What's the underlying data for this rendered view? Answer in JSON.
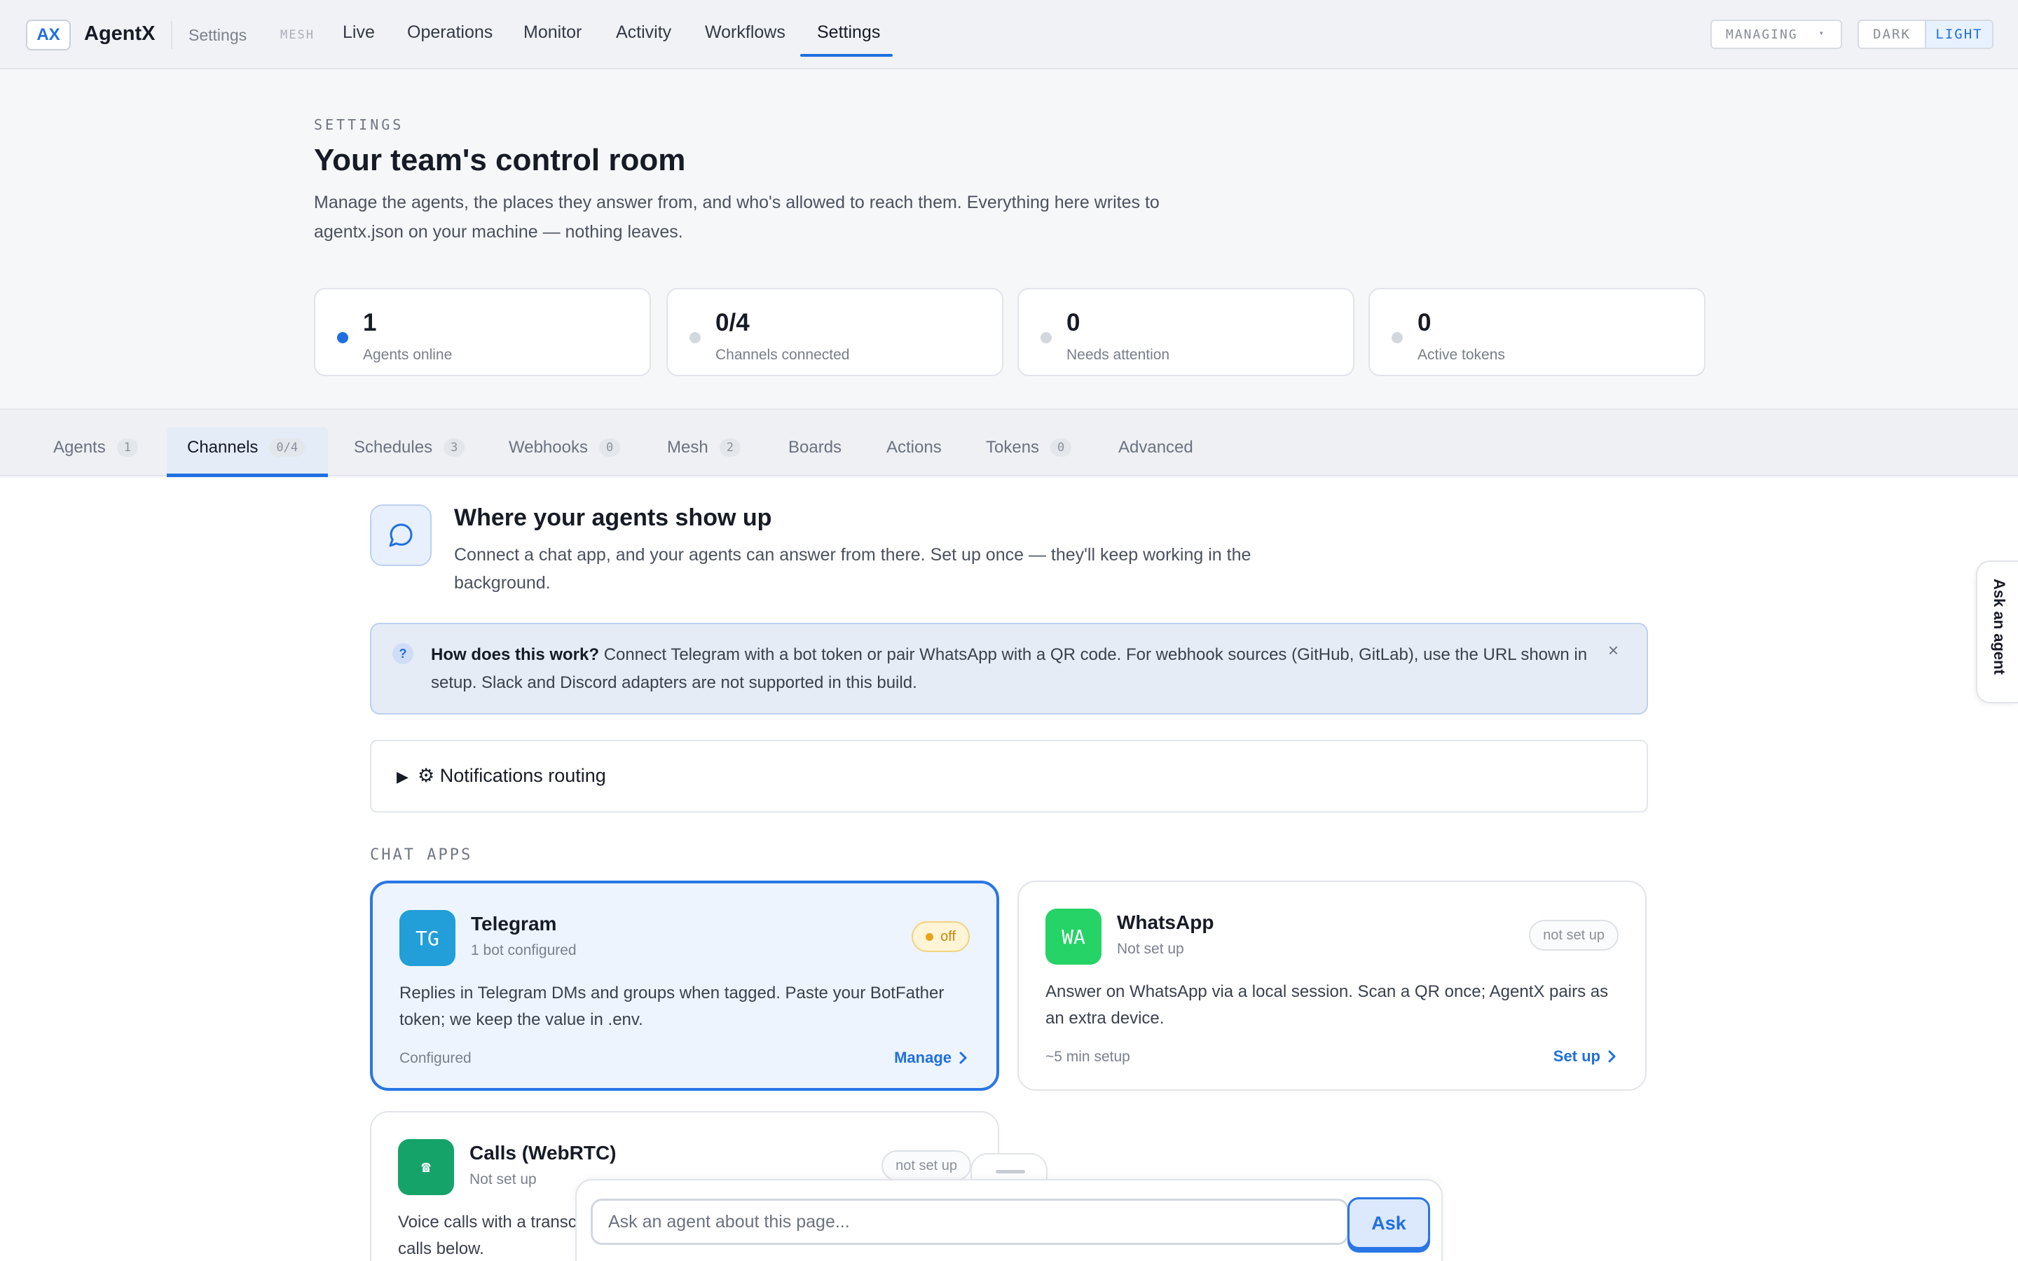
{
  "topbar": {
    "logo": "AX",
    "brand": "AgentX",
    "breadcrumb": "Settings",
    "mesh_tag": "MESH",
    "nav": [
      "Live",
      "Operations",
      "Monitor",
      "Activity",
      "Workflows",
      "Settings"
    ],
    "active_nav": "Settings",
    "managing_label": "MANAGING",
    "theme_dark": "DARK",
    "theme_light": "LIGHT",
    "active_theme": "LIGHT"
  },
  "header": {
    "eyebrow": "SETTINGS",
    "title": "Your team's control room",
    "description": "Manage the agents, the places they answer from, and who's allowed to reach them. Everything here writes to agentx.json on your machine — nothing leaves."
  },
  "stats": [
    {
      "value": "1",
      "label": "Agents online",
      "status": "active"
    },
    {
      "value": "0/4",
      "label": "Channels connected",
      "status": "idle"
    },
    {
      "value": "0",
      "label": "Needs attention",
      "status": "idle"
    },
    {
      "value": "0",
      "label": "Active tokens",
      "status": "idle"
    }
  ],
  "tabs": [
    {
      "label": "Agents",
      "count": "1"
    },
    {
      "label": "Channels",
      "count": "0/4"
    },
    {
      "label": "Schedules",
      "count": "3"
    },
    {
      "label": "Webhooks",
      "count": "0"
    },
    {
      "label": "Mesh",
      "count": "2"
    },
    {
      "label": "Boards",
      "count": ""
    },
    {
      "label": "Actions",
      "count": ""
    },
    {
      "label": "Tokens",
      "count": "0"
    },
    {
      "label": "Advanced",
      "count": ""
    }
  ],
  "active_tab": "Channels",
  "channels": {
    "title": "Where your agents show up",
    "description": "Connect a chat app, and your agents can answer from there. Set up once — they'll keep working in the background.",
    "info": {
      "heading": "How does this work?",
      "text": "Connect Telegram with a bot token or pair WhatsApp with a QR code. For webhook sources (GitHub, GitLab), use the URL shown in setup. Slack and Discord adapters are not supported in this build.",
      "close": "×"
    },
    "notifications": {
      "arrow": "▶",
      "label": "⚙ Notifications routing"
    },
    "group_label": "CHAT APPS",
    "cards": [
      {
        "initials": "TG",
        "name": "Telegram",
        "sub": "1 bot configured",
        "badge": "off",
        "color": "#229ED9",
        "description": "Replies in Telegram DMs and groups when tagged. Paste your BotFather token; we keep the value in .env.",
        "footer": "Configured",
        "action": "Manage"
      },
      {
        "initials": "WA",
        "name": "WhatsApp",
        "sub": "Not set up",
        "badge": "not set up",
        "color": "#25D366",
        "description": "Answer on WhatsApp via a local session. Scan a QR once; AgentX pairs as an extra device.",
        "footer": "~5 min setup",
        "action": "Set up"
      },
      {
        "initials": "☎",
        "name": "Calls (WebRTC)",
        "sub": "Not set up",
        "badge": "not set up",
        "color": "#16a36a",
        "description": "Voice calls with a transcript. calls below."
      }
    ]
  },
  "side_tab": "Ask an agent",
  "ask": {
    "placeholder": "Ask an agent about this page...",
    "button": "Ask"
  }
}
